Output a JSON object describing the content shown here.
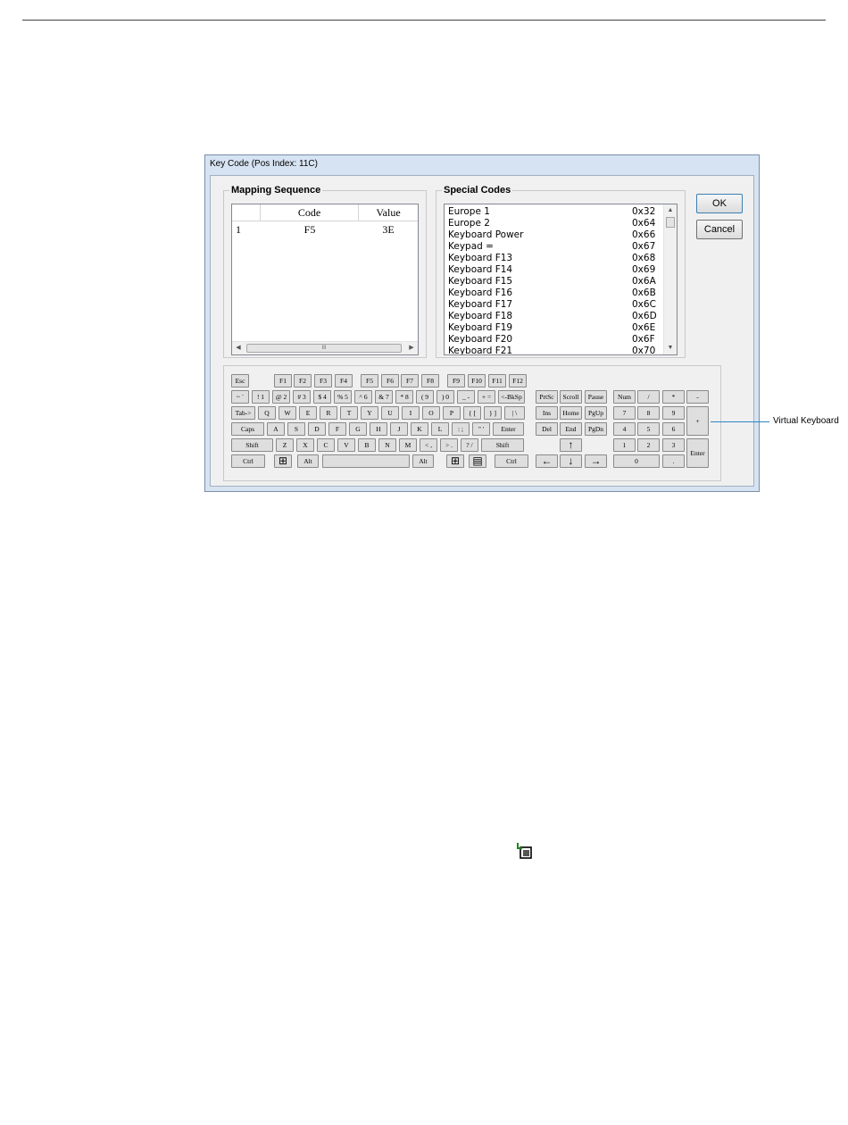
{
  "window": {
    "title": "Key Code (Pos Index: 11C)"
  },
  "mapping": {
    "label": "Mapping Sequence",
    "columns": [
      "",
      "Code",
      "Value"
    ],
    "rows": [
      {
        "index": "1",
        "code": "F5",
        "value": "3E"
      }
    ],
    "scroll_grip": "III"
  },
  "special": {
    "label": "Special Codes",
    "items": [
      {
        "name": "Europe 1",
        "code": "0x32"
      },
      {
        "name": "Europe 2",
        "code": "0x64"
      },
      {
        "name": "Keyboard Power",
        "code": "0x66"
      },
      {
        "name": "Keypad =",
        "code": "0x67"
      },
      {
        "name": "Keyboard F13",
        "code": "0x68"
      },
      {
        "name": "Keyboard F14",
        "code": "0x69"
      },
      {
        "name": "Keyboard F15",
        "code": "0x6A"
      },
      {
        "name": "Keyboard F16",
        "code": "0x6B"
      },
      {
        "name": "Keyboard F17",
        "code": "0x6C"
      },
      {
        "name": "Keyboard F18",
        "code": "0x6D"
      },
      {
        "name": "Keyboard F19",
        "code": "0x6E"
      },
      {
        "name": "Keyboard F20",
        "code": "0x6F"
      },
      {
        "name": "Keyboard F21",
        "code": "0x70"
      }
    ]
  },
  "buttons": {
    "ok": "OK",
    "cancel": "Cancel"
  },
  "keyboard": {
    "esc": "Esc",
    "fkeys": [
      "F1",
      "F2",
      "F3",
      "F4",
      "F5",
      "F6",
      "F7",
      "F8",
      "F9",
      "F10",
      "F11",
      "F12"
    ],
    "row_numbers": [
      "~ `",
      "! 1",
      "@ 2",
      "# 3",
      "$ 4",
      "% 5",
      "^ 6",
      "& 7",
      "* 8",
      "( 9",
      ") 0",
      "_ -",
      "+ =",
      "<-BkSp"
    ],
    "row_top": [
      "Tab->",
      "Q",
      "W",
      "E",
      "R",
      "T",
      "Y",
      "U",
      "I",
      "O",
      "P",
      "{ [",
      "} ]",
      "| \\"
    ],
    "row_home": [
      "Caps",
      "A",
      "S",
      "D",
      "F",
      "G",
      "H",
      "J",
      "K",
      "L",
      ": ;",
      "\" '",
      "Enter"
    ],
    "row_shift": [
      "Shift",
      "Z",
      "X",
      "C",
      "V",
      "B",
      "N",
      "M",
      "< ,",
      "> .",
      "? /",
      "Shift"
    ],
    "row_bottom": {
      "ctrl_l": "Ctrl",
      "alt_l": "Alt",
      "space": "",
      "alt_r": "Alt",
      "ctrl_r": "Ctrl"
    },
    "nav_top": [
      "PrtSc",
      "Scroll",
      "Pause"
    ],
    "nav_mid1": [
      "Ins",
      "Home",
      "PgUp"
    ],
    "nav_mid2": [
      "Del",
      "End",
      "PgDn"
    ],
    "arrows": {
      "up": "↑",
      "left": "←",
      "down": "↓",
      "right": "→"
    },
    "numpad": {
      "row0": [
        "Num",
        "/",
        "*",
        "-"
      ],
      "row1": [
        "7",
        "8",
        "9"
      ],
      "plus": "+",
      "row2": [
        "4",
        "5",
        "6"
      ],
      "row3": [
        "1",
        "2",
        "3"
      ],
      "enter": "Enter",
      "zero": "0",
      "dot": "."
    }
  },
  "callout": "Virtual Keyboard"
}
